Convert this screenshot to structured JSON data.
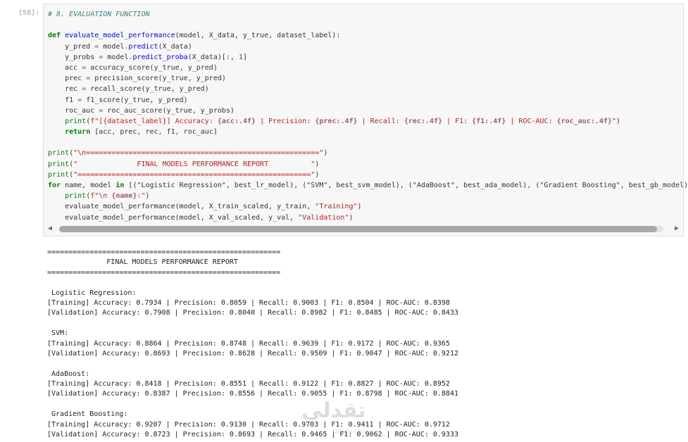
{
  "cell": {
    "prompt": "[58]:",
    "comment": "# 8. EVALUATION FUNCTION",
    "function_name": "evaluate_model_performance",
    "function_params": "(model, X_data, y_true, dataset_label):",
    "print_label_dataset": "[{dataset_label}] Accuracy: ",
    "print_acc": "{acc:",
    "print_prec_label": " | Precision: ",
    "print_prec": "{prec:",
    "print_rec_label": " | Recall: ",
    "print_rec": "{rec:",
    "print_f1_label": " | F1: ",
    "print_f1": "{f1:",
    "print_roc_label": " | ROC-AUC: ",
    "print_roc": "{roc_auc:",
    "fmt": ".4f}",
    "separator_string": "\"\\n=======================================================\"",
    "separator_string2": "\"=======================================================\"",
    "title_string": "\"              FINAL MODELS PERFORMANCE REPORT          \"",
    "models_list": "[(\"Logistic Regression\", best_lr_model), (\"SVM\", best_svm_model), (\"AdaBoost\", best_ada_model), (\"Gradient Boosting\", best_gb_model)]:",
    "training_label": "\"Training\"",
    "validation_label": "\"Validation\""
  },
  "scrollbar": {
    "left_arrow": "◀",
    "right_arrow": "▶",
    "thumb_fraction": 0.99
  },
  "output": {
    "lines": [
      "=======================================================",
      "              FINAL MODELS PERFORMANCE REPORT",
      "=======================================================",
      "",
      " Logistic Regression:",
      "[Training] Accuracy: 0.7934 | Precision: 0.8059 | Recall: 0.9003 | F1: 0.8504 | ROC-AUC: 0.8398",
      "[Validation] Accuracy: 0.7908 | Precision: 0.8040 | Recall: 0.8982 | F1: 0.8485 | ROC-AUC: 0.8433",
      "",
      " SVM:",
      "[Training] Accuracy: 0.8864 | Precision: 0.8748 | Recall: 0.9639 | F1: 0.9172 | ROC-AUC: 0.9365",
      "[Validation] Accuracy: 0.8693 | Precision: 0.8628 | Recall: 0.9509 | F1: 0.9047 | ROC-AUC: 0.9212",
      "",
      " AdaBoost:",
      "[Training] Accuracy: 0.8418 | Precision: 0.8551 | Recall: 0.9122 | F1: 0.8827 | ROC-AUC: 0.8952",
      "[Validation] Accuracy: 0.8387 | Precision: 0.8556 | Recall: 0.9055 | F1: 0.8798 | ROC-AUC: 0.8841",
      "",
      " Gradient Boosting:",
      "[Training] Accuracy: 0.9207 | Precision: 0.9130 | Recall: 0.9703 | F1: 0.9411 | ROC-AUC: 0.9712",
      "[Validation] Accuracy: 0.8723 | Precision: 0.8693 | Recall: 0.9465 | F1: 0.9062 | ROC-AUC: 0.9333"
    ]
  },
  "watermark": {
    "logo_text": "تقدلي",
    "sub_text": "tafdly.com"
  }
}
